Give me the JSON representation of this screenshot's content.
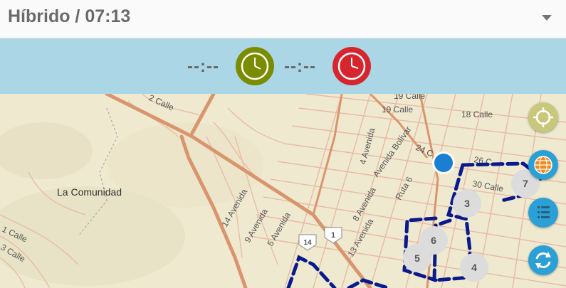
{
  "header": {
    "title": "Híbrido / 07:13"
  },
  "times": {
    "start": "--:--",
    "end": "--:--"
  },
  "colors": {
    "start_clock": "#7a8c00",
    "end_clock": "#d7252e",
    "route": "#0a1a8c",
    "location": "#1a7fd0"
  },
  "map": {
    "area_label": "La Comunidad",
    "streets": [
      "19 Calle",
      "18 Calle",
      "24 C",
      "26 C",
      "30 Calle",
      "1 Calle",
      "3 Calle",
      "4 Avenida",
      "Avenida Bolívar",
      "Ruta 6",
      "14 Avenida",
      "9 Avenida",
      "8 Avenida",
      "13 Avenida",
      "5 Avenida",
      "2 Calle"
    ],
    "shields": [
      "14",
      "1"
    ],
    "markers": [
      "7",
      "3",
      "6",
      "5",
      "4"
    ]
  },
  "icons": [
    "start-clock-icon",
    "end-clock-icon",
    "crosshair-icon",
    "globe-icon",
    "layers-list-icon",
    "refresh-icon",
    "location-dot-icon",
    "dropdown-caret-icon"
  ]
}
